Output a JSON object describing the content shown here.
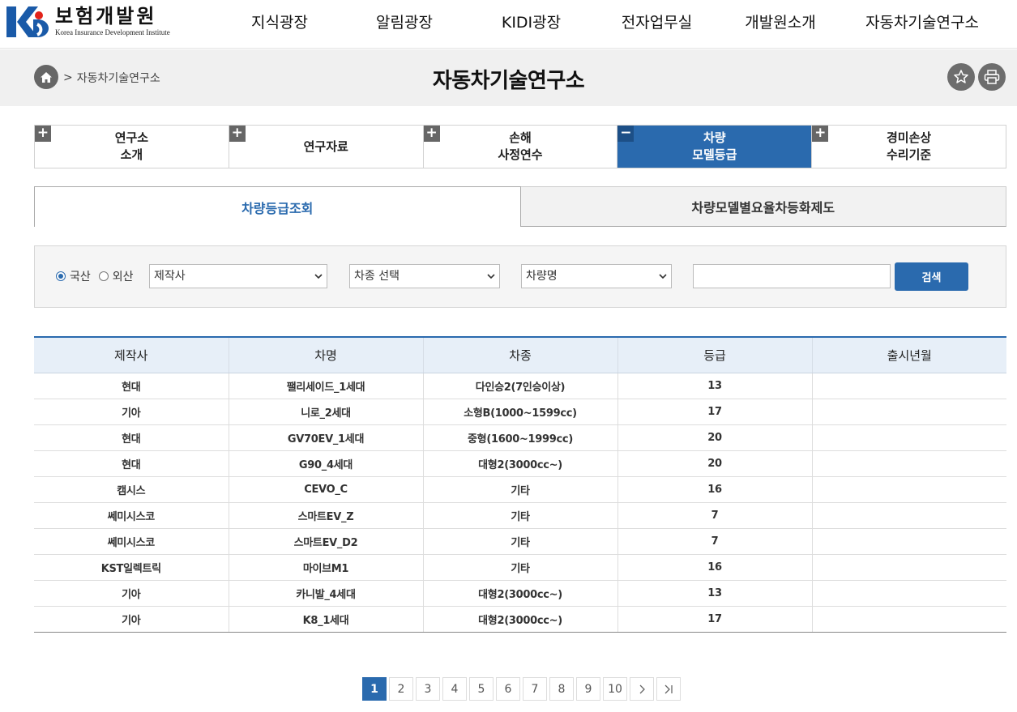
{
  "header": {
    "logo_ko": "보험개발원",
    "logo_en": "Korea Insurance Development Institute",
    "nav": [
      "지식광장",
      "알림광장",
      "KIDI광장",
      "전자업무실",
      "개발원소개",
      "자동차기술연구소"
    ]
  },
  "titlebar": {
    "breadcrumb_sep": ">",
    "breadcrumb_current": "자동차기술연구소",
    "title": "자동차기술연구소"
  },
  "submenu": [
    {
      "label": "연구소\n소개",
      "toggle": "+",
      "active": false
    },
    {
      "label": "연구자료",
      "toggle": "+",
      "active": false
    },
    {
      "label": "손해\n사정연수",
      "toggle": "+",
      "active": false
    },
    {
      "label": "차량\n모델등급",
      "toggle": "−",
      "active": true
    },
    {
      "label": "경미손상\n수리기준",
      "toggle": "+",
      "active": false
    }
  ],
  "tabs": [
    {
      "label": "차량등급조회",
      "active": true
    },
    {
      "label": "차량모델별요율차등화제도",
      "active": false
    }
  ],
  "search": {
    "radio_domestic": "국산",
    "radio_import": "외산",
    "maker_select": "제작사",
    "type_select": "차종 선택",
    "model_select": "차량명",
    "keyword_value": "",
    "button": "검색"
  },
  "table": {
    "headers": [
      "제작사",
      "차명",
      "차종",
      "등급",
      "출시년월"
    ],
    "rows": [
      [
        "현대",
        "팰리세이드_1세대",
        "다인승2(7인승이상)",
        "13",
        ""
      ],
      [
        "기아",
        "니로_2세대",
        "소형B(1000~1599cc)",
        "17",
        ""
      ],
      [
        "현대",
        "GV70EV_1세대",
        "중형(1600~1999cc)",
        "20",
        ""
      ],
      [
        "현대",
        "G90_4세대",
        "대형2(3000cc~)",
        "20",
        ""
      ],
      [
        "캠시스",
        "CEVO_C",
        "기타",
        "16",
        ""
      ],
      [
        "쎄미시스코",
        "스마트EV_Z",
        "기타",
        "7",
        ""
      ],
      [
        "쎄미시스코",
        "스마트EV_D2",
        "기타",
        "7",
        ""
      ],
      [
        "KST일렉트릭",
        "마이브M1",
        "기타",
        "16",
        ""
      ],
      [
        "기아",
        "카니발_4세대",
        "대형2(3000cc~)",
        "13",
        ""
      ],
      [
        "기아",
        "K8_1세대",
        "대형2(3000cc~)",
        "17",
        ""
      ]
    ]
  },
  "pagination": {
    "pages": [
      "1",
      "2",
      "3",
      "4",
      "5",
      "6",
      "7",
      "8",
      "9",
      "10"
    ],
    "current": "1"
  },
  "colors": {
    "accent": "#2a6aae",
    "logo_blue": "#1a5aa8",
    "logo_red": "#e2231a"
  }
}
